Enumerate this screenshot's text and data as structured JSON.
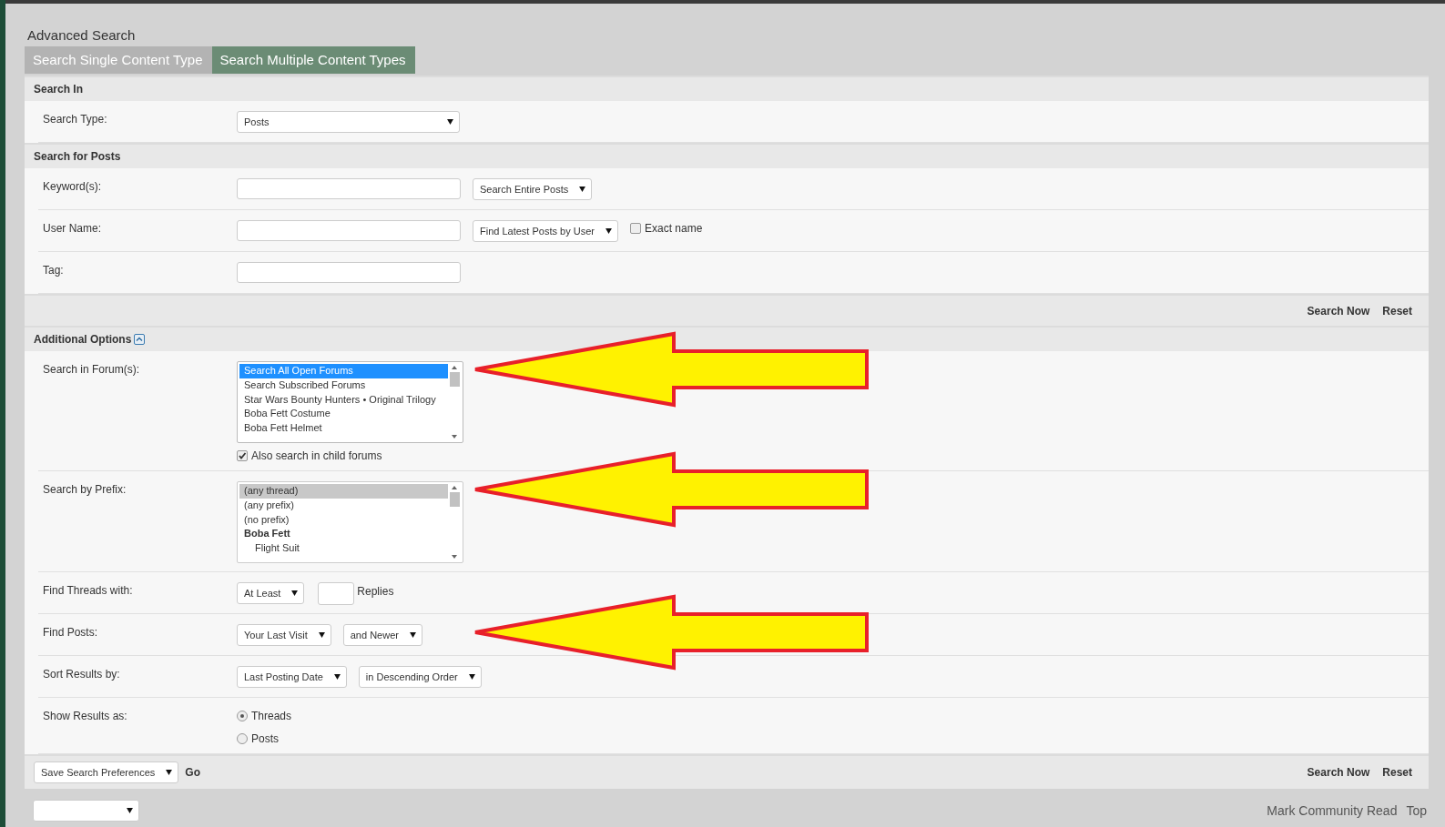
{
  "page": {
    "title": "Advanced Search"
  },
  "tabs": [
    {
      "label": "Search Single Content Type",
      "selected": false
    },
    {
      "label": "Search Multiple Content Types",
      "selected": true
    }
  ],
  "sections": [
    {
      "title": "Search In",
      "rows": [
        {
          "label": "Search Type:",
          "controls": [
            {
              "kind": "wide-select",
              "value": "Posts"
            }
          ]
        }
      ]
    },
    {
      "title": "Search for Posts",
      "rows": [
        {
          "label": "Keyword(s):",
          "controls": [
            {
              "kind": "text"
            },
            {
              "kind": "select",
              "value": "Search Entire Posts"
            }
          ]
        },
        {
          "label": "User Name:",
          "controls": [
            {
              "kind": "text"
            },
            {
              "kind": "select",
              "value": "Find Latest Posts by User"
            },
            {
              "kind": "checkbox",
              "label": "Exact name",
              "checked": false
            }
          ]
        },
        {
          "label": "Tag:",
          "controls": [
            {
              "kind": "text"
            }
          ]
        }
      ],
      "buttons": [
        "Search Now",
        "Reset"
      ]
    },
    {
      "title": "Additional Options",
      "expanded": true,
      "rows": [
        {
          "label": "Search in Forum(s):",
          "annotated": true,
          "controls": [
            {
              "kind": "listbox",
              "focused": true,
              "options": [
                {
                  "text": "Search All Open Forums",
                  "selected": true
                },
                {
                  "text": "Search Subscribed Forums",
                  "selected": false
                },
                {
                  "text": "Star Wars Bounty Hunters • Original Trilogy",
                  "selected": false
                },
                {
                  "text": "Boba Fett Costume",
                  "selected": false
                },
                {
                  "text": "Boba Fett Helmet",
                  "selected": false
                }
              ]
            },
            {
              "kind": "checkbox",
              "label": "Also search in child forums",
              "checked": true
            }
          ]
        },
        {
          "label": "Search by Prefix:",
          "annotated": true,
          "controls": [
            {
              "kind": "listbox",
              "focused": false,
              "options": [
                {
                  "text": "(any thread)",
                  "selected": true
                },
                {
                  "text": "(any prefix)",
                  "selected": false
                },
                {
                  "text": "(no prefix)",
                  "selected": false
                },
                {
                  "text": "Boba Fett",
                  "selected": false,
                  "kind": "group",
                  "children": [
                    {
                      "text": "Flight Suit",
                      "selected": false
                    }
                  ]
                }
              ]
            }
          ]
        },
        {
          "label": "Find Threads with:",
          "annotated": false,
          "controls": [
            {
              "kind": "select",
              "value": "At Least"
            },
            {
              "kind": "number"
            },
            {
              "kind": "note",
              "label": "Replies"
            }
          ]
        },
        {
          "label": "Find Posts:",
          "annotated": true,
          "controls": [
            {
              "kind": "select",
              "value": "Your Last Visit"
            },
            {
              "kind": "select",
              "value": "and Newer"
            }
          ]
        },
        {
          "label": "Sort Results by:",
          "annotated": false,
          "controls": [
            {
              "kind": "select",
              "value": "Last Posting Date"
            },
            {
              "kind": "select",
              "value": "in Descending Order"
            }
          ]
        },
        {
          "label": "Show Results as:",
          "annotated": false,
          "controls": [
            {
              "kind": "radios",
              "options": [
                {
                  "label": "Threads",
                  "selected": true
                },
                {
                  "label": "Posts",
                  "selected": false
                }
              ]
            }
          ]
        }
      ],
      "footer_select": {
        "value": "Save Search Preferences",
        "go": "Go"
      },
      "buttons": [
        "Search Now",
        "Reset"
      ]
    }
  ],
  "bottom": {
    "links": [
      "Mark Community Read",
      "Top"
    ]
  }
}
